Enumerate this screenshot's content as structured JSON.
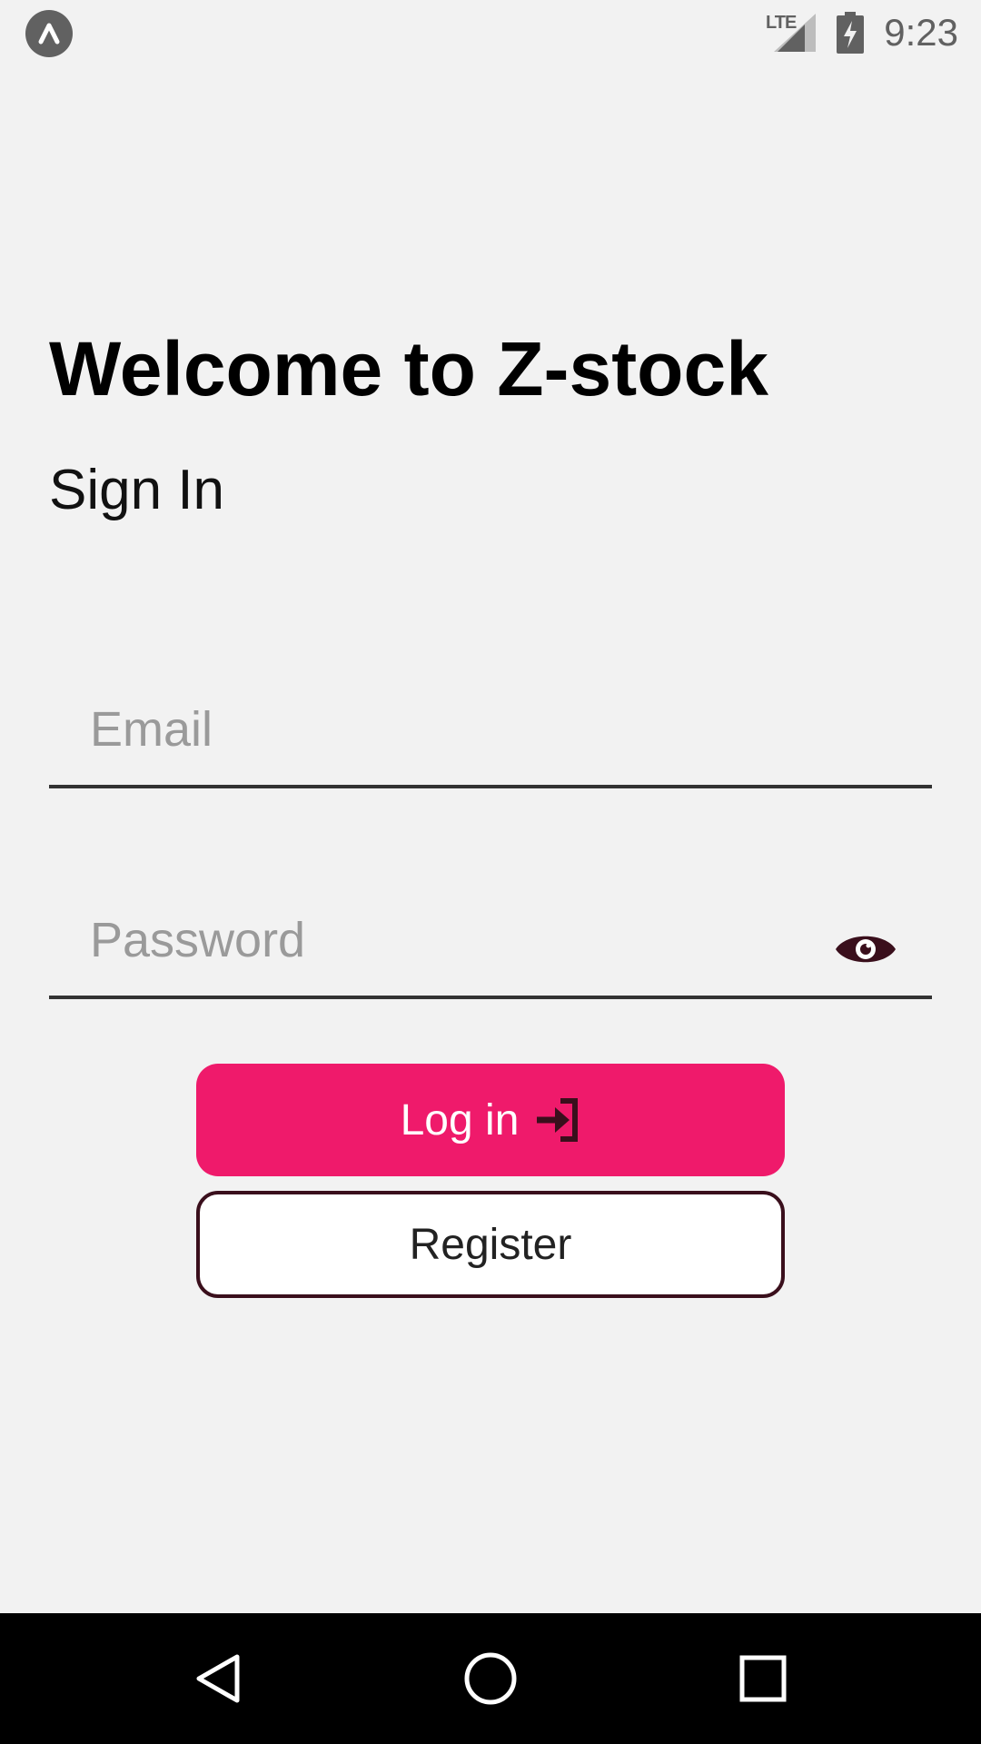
{
  "status_bar": {
    "network": "LTE",
    "time": "9:23",
    "app_icon": "app-badge-icon",
    "signal_icon": "cell-signal-icon",
    "battery_icon": "battery-charging-icon"
  },
  "header": {
    "title": "Welcome to Z-stock",
    "subtitle": "Sign In"
  },
  "form": {
    "email": {
      "value": "",
      "placeholder": "Email"
    },
    "password": {
      "value": "",
      "placeholder": "Password",
      "toggle_icon": "eye-icon"
    }
  },
  "actions": {
    "login_label": "Log in",
    "login_icon": "login-arrow-icon",
    "register_label": "Register"
  },
  "nav_bar": {
    "back_icon": "back-triangle-icon",
    "home_icon": "home-circle-icon",
    "recents_icon": "recents-square-icon"
  },
  "colors": {
    "background": "#f2f2f2",
    "accent": "#ef1a6b",
    "dark_accent": "#3a0f1c",
    "placeholder": "#9a9a9a",
    "status_gray": "#616161"
  }
}
